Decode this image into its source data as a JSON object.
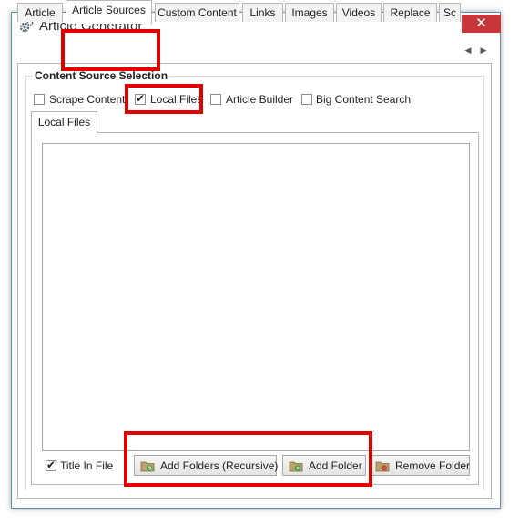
{
  "window": {
    "title": "Article Generator",
    "close_glyph": "✕",
    "icon": "gear-icon"
  },
  "tabs": [
    {
      "label": "Article",
      "active": false
    },
    {
      "label": "Article Sources",
      "active": true
    },
    {
      "label": "Custom Content",
      "active": false
    },
    {
      "label": "Links",
      "active": false
    },
    {
      "label": "Images",
      "active": false
    },
    {
      "label": "Videos",
      "active": false
    },
    {
      "label": "Replace",
      "active": false
    },
    {
      "label": "Sc",
      "active": false
    }
  ],
  "tab_scroll": {
    "left": "◀",
    "right": "▶"
  },
  "group": {
    "title": "Content Source Selection",
    "sources": [
      {
        "label": "Scrape Content",
        "checked": false
      },
      {
        "label": "Local Files",
        "checked": true
      },
      {
        "label": "Article Builder",
        "checked": false
      },
      {
        "label": "Big Content Search",
        "checked": false
      }
    ]
  },
  "subtab": {
    "label": "Local Files"
  },
  "local_files": {
    "items": [],
    "title_in_file": {
      "label": "Title In File",
      "checked": true
    },
    "buttons": {
      "add_recursive": "Add Folders (Recursive)",
      "add_folder": "Add Folder",
      "remove_folder": "Remove Folder"
    }
  },
  "colors": {
    "highlight": "#e00000",
    "close": "#c7373a"
  }
}
